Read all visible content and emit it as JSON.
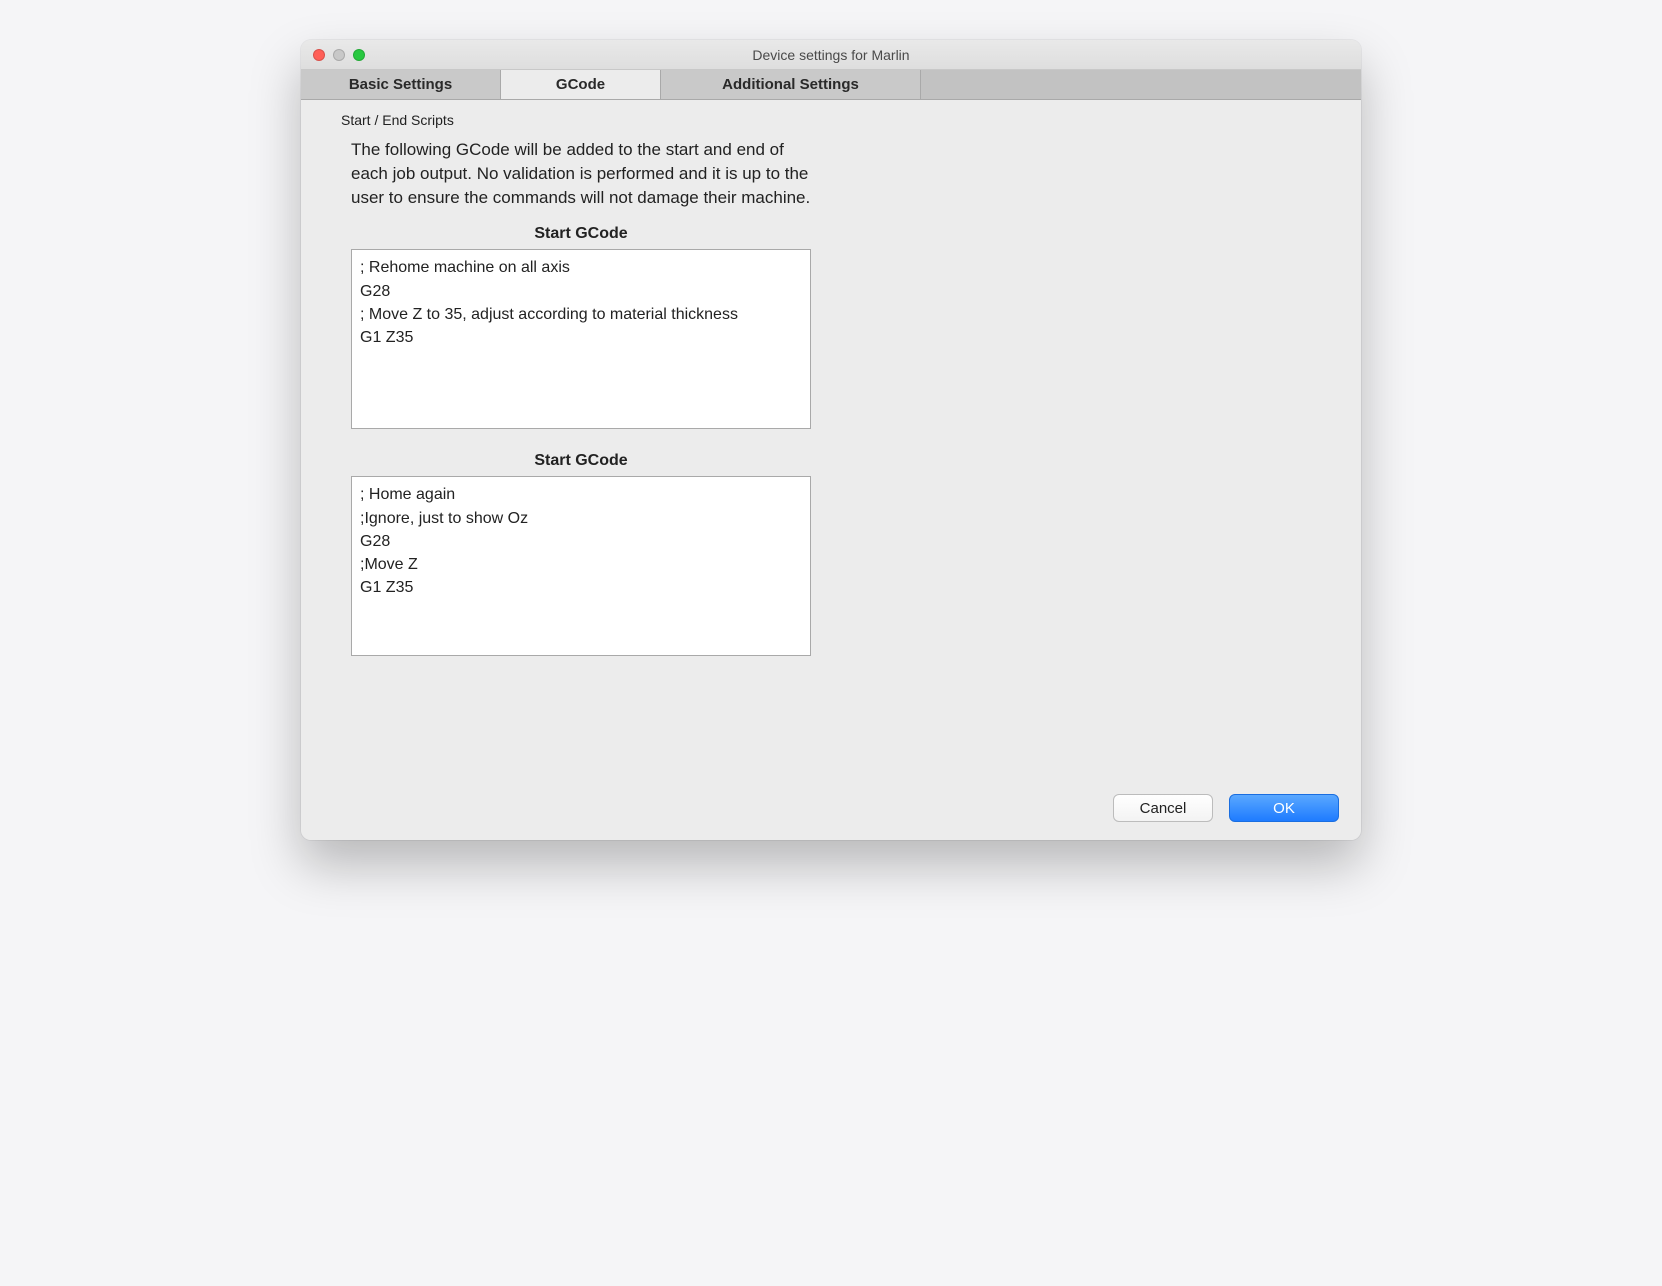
{
  "window": {
    "title": "Device settings for Marlin"
  },
  "tabs": {
    "basic": "Basic Settings",
    "gcode": "GCode",
    "additional": "Additional Settings"
  },
  "section": {
    "heading": "Start / End Scripts",
    "description": "The following GCode will be added to the start and end of each job output. No validation is performed and it is up to the user to ensure the commands will not damage their machine."
  },
  "gcode": {
    "start_label": "Start GCode",
    "start_value": "; Rehome machine on all axis\nG28\n; Move Z to 35, adjust according to material thickness\nG1 Z35",
    "end_label": "Start GCode",
    "end_value": "; Home again\n;Ignore, just to show Oz\nG28\n;Move Z\nG1 Z35"
  },
  "buttons": {
    "cancel": "Cancel",
    "ok": "OK"
  }
}
